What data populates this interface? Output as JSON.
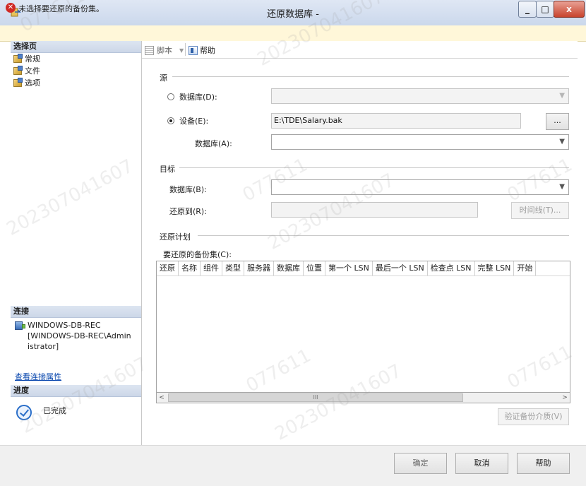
{
  "window": {
    "title": "还原数据库 -",
    "min_label": "_",
    "max_label": "□",
    "close_label": "x"
  },
  "error_bar": {
    "icon": "error-icon",
    "icon_glyph": "✕",
    "text": "未选择要还原的备份集。"
  },
  "left_pane": {
    "select_page_header": "选择页",
    "pages": [
      {
        "label": "常规"
      },
      {
        "label": "文件"
      },
      {
        "label": "选项"
      }
    ],
    "connection_header": "连接",
    "connection_lines": [
      "WINDOWS-DB-REC",
      "[WINDOWS-DB-REC\\Admin",
      "istrator]"
    ],
    "view_connection_link": "查看连接属性",
    "progress_header": "进度",
    "progress_status": "已完成"
  },
  "toolbar": {
    "script_label": "脚本",
    "help_label": "帮助"
  },
  "source": {
    "header": "源",
    "database_radio_label": "数据库(D):",
    "device_radio_label": "设备(E):",
    "device_path": "E:\\TDE\\Salary.bak",
    "browse_label": "...",
    "device_database_label": "数据库(A):",
    "selected": "device"
  },
  "destination": {
    "header": "目标",
    "database_label": "数据库(B):",
    "restore_to_label": "还原到(R):",
    "timeline_button": "时间线(T)..."
  },
  "restore_plan": {
    "header": "还原计划",
    "backup_sets_label": "要还原的备份集(C):",
    "columns": [
      "还原",
      "名称",
      "组件",
      "类型",
      "服务器",
      "数据库",
      "位置",
      "第一个 LSN",
      "最后一个 LSN",
      "检查点 LSN",
      "完整 LSN",
      "开始"
    ],
    "rows": [],
    "scroll_left": "<",
    "scroll_right": ">",
    "scroll_thumb": "III",
    "verify_button": "验证备份介质(V)"
  },
  "footer": {
    "ok_label": "确定",
    "cancel_label": "取消",
    "help_label": "帮助"
  },
  "watermarks": [
    "077611",
    "202307041607"
  ]
}
